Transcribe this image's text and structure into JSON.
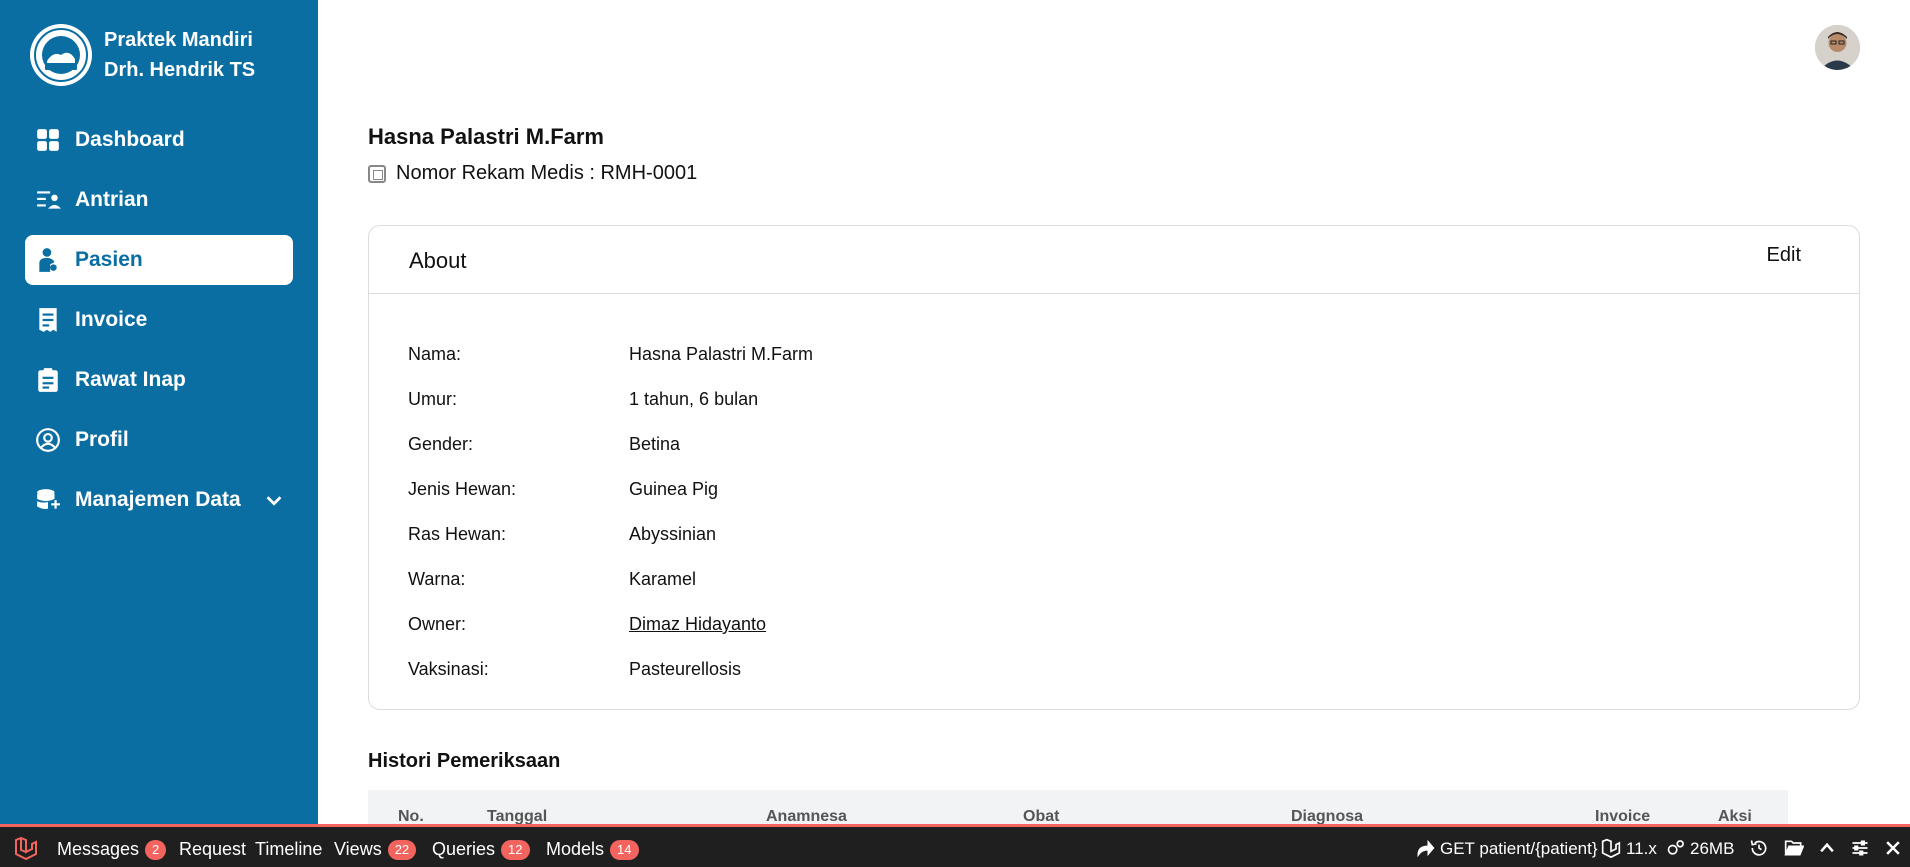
{
  "brand": {
    "line1": "Praktek Mandiri",
    "line2": "Drh. Hendrik TS"
  },
  "sidebar": {
    "items": [
      {
        "label": "Dashboard",
        "icon": "grid-icon"
      },
      {
        "label": "Antrian",
        "icon": "queue-icon"
      },
      {
        "label": "Pasien",
        "icon": "patient-icon",
        "active": true
      },
      {
        "label": "Invoice",
        "icon": "receipt-icon"
      },
      {
        "label": "Rawat Inap",
        "icon": "clipboard-icon"
      },
      {
        "label": "Profil",
        "icon": "user-circle-icon"
      },
      {
        "label": "Manajemen Data",
        "icon": "database-icon"
      }
    ]
  },
  "patient": {
    "name": "Hasna Palastri M.Farm",
    "record_label": "Nomor Rekam Medis : RMH-0001"
  },
  "about": {
    "title": "About",
    "edit_label": "Edit",
    "rows": [
      {
        "label": "Nama:",
        "value": "Hasna Palastri M.Farm"
      },
      {
        "label": "Umur:",
        "value": "1 tahun, 6 bulan"
      },
      {
        "label": "Gender:",
        "value": "Betina"
      },
      {
        "label": "Jenis Hewan:",
        "value": "Guinea Pig"
      },
      {
        "label": "Ras Hewan:",
        "value": "Abyssinian"
      },
      {
        "label": "Warna:",
        "value": "Karamel"
      },
      {
        "label": "Owner:",
        "value": "Dimaz Hidayanto"
      },
      {
        "label": "Vaksinasi:",
        "value": "Pasteurellosis"
      }
    ]
  },
  "history": {
    "title": "Histori Pemeriksaan",
    "columns": [
      "No.",
      "Tanggal",
      "Anamnesa",
      "Obat",
      "Diagnosa",
      "Invoice",
      "Aksi"
    ]
  },
  "debugbar": {
    "tabs": [
      {
        "label": "Messages",
        "count": "2"
      },
      {
        "label": "Request",
        "count": ""
      },
      {
        "label": "Timeline",
        "count": ""
      },
      {
        "label": "Views",
        "count": "22"
      },
      {
        "label": "Queries",
        "count": "12"
      },
      {
        "label": "Models",
        "count": "14"
      }
    ],
    "route": "GET patient/{patient}",
    "version": "11.x",
    "memory": "26MB"
  },
  "colors": {
    "primary": "#0a6ea3",
    "debug_accent": "#f4645f"
  }
}
